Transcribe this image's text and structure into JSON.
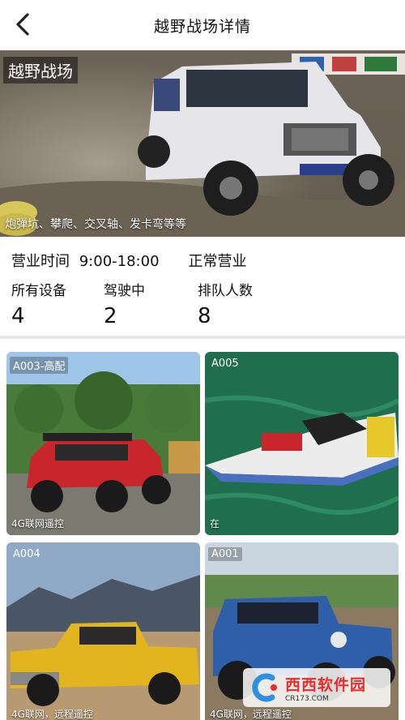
{
  "header": {
    "title": "越野战场详情",
    "back_icon": "chevron-left-icon"
  },
  "hero": {
    "label": "越野战场",
    "caption": "炮弹坑、攀爬、交叉轴、发卡弯等等"
  },
  "info": {
    "hours_label": "营业时间",
    "hours_value": "9:00-18:00",
    "status": "正常营业",
    "stats": [
      {
        "label": "所有设备",
        "value": "4"
      },
      {
        "label": "驾驶中",
        "value": "2"
      },
      {
        "label": "排队人数",
        "value": "8"
      }
    ]
  },
  "devices": [
    {
      "code": "A003-高配",
      "tag": "4G联网遥控"
    },
    {
      "code": "A005",
      "tag": "在"
    },
    {
      "code": "A004",
      "tag": "4G联网，远程遥控"
    },
    {
      "code": "A001",
      "tag": "4G联网，远程遥控"
    }
  ],
  "watermark": {
    "main": "西西软件园",
    "sub": "CR173.COM"
  },
  "colors": {
    "accent_red": "#e52e2e",
    "divider": "#e8e8e8"
  }
}
